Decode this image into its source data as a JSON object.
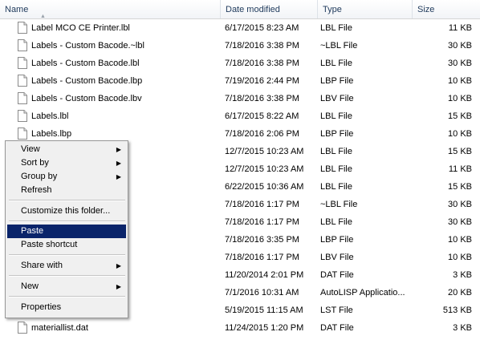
{
  "columns": {
    "name": "Name",
    "date": "Date modified",
    "type": "Type",
    "size": "Size"
  },
  "icons": {
    "file": "file-icon",
    "sort": "sort-ascending-icon",
    "submenu": "submenu-arrow-icon"
  },
  "files": [
    {
      "name": "Label MCO CE Printer.lbl",
      "date": "6/17/2015 8:23 AM",
      "type": "LBL File",
      "size": "11 KB"
    },
    {
      "name": "Labels - Custom Bacode.~lbl",
      "date": "7/18/2016 3:38 PM",
      "type": "~LBL File",
      "size": "30 KB"
    },
    {
      "name": "Labels - Custom Bacode.lbl",
      "date": "7/18/2016 3:38 PM",
      "type": "LBL File",
      "size": "30 KB"
    },
    {
      "name": "Labels - Custom Bacode.lbp",
      "date": "7/19/2016 2:44 PM",
      "type": "LBP File",
      "size": "10 KB"
    },
    {
      "name": "Labels - Custom Bacode.lbv",
      "date": "7/18/2016 3:38 PM",
      "type": "LBV File",
      "size": "10 KB"
    },
    {
      "name": "Labels.lbl",
      "date": "6/17/2015 8:22 AM",
      "type": "LBL File",
      "size": "15 KB"
    },
    {
      "name": "Labels.lbp",
      "date": "7/18/2016 2:06 PM",
      "type": "LBP File",
      "size": "10 KB"
    },
    {
      "name": "",
      "date": "12/7/2015 10:23 AM",
      "type": "LBL File",
      "size": "15 KB"
    },
    {
      "name": "",
      "date": "12/7/2015 10:23 AM",
      "type": "LBL File",
      "size": "11 KB"
    },
    {
      "name": "",
      "date": "6/22/2015 10:36 AM",
      "type": "LBL File",
      "size": "15 KB"
    },
    {
      "name": "",
      "date": "7/18/2016 1:17 PM",
      "type": "~LBL File",
      "size": "30 KB"
    },
    {
      "name": "",
      "date": "7/18/2016 1:17 PM",
      "type": "LBL File",
      "size": "30 KB"
    },
    {
      "name": "",
      "date": "7/18/2016 3:35 PM",
      "type": "LBP File",
      "size": "10 KB"
    },
    {
      "name": "",
      "date": "7/18/2016 1:17 PM",
      "type": "LBV File",
      "size": "10 KB"
    },
    {
      "name": "",
      "date": "11/20/2014 2:01 PM",
      "type": "DAT File",
      "size": "3 KB"
    },
    {
      "name": "",
      "date": "7/1/2016 10:31 AM",
      "type": "AutoLISP Applicatio...",
      "size": "20 KB"
    },
    {
      "name": "",
      "date": "5/19/2015 11:15 AM",
      "type": "LST File",
      "size": "513 KB"
    },
    {
      "name": "materiallist.dat",
      "date": "11/24/2015 1:20 PM",
      "type": "DAT File",
      "size": "3 KB"
    }
  ],
  "context_menu": {
    "view": "View",
    "sort_by": "Sort by",
    "group_by": "Group by",
    "refresh": "Refresh",
    "customize": "Customize this folder...",
    "paste": "Paste",
    "paste_shortcut": "Paste shortcut",
    "share_with": "Share with",
    "new": "New",
    "properties": "Properties"
  }
}
